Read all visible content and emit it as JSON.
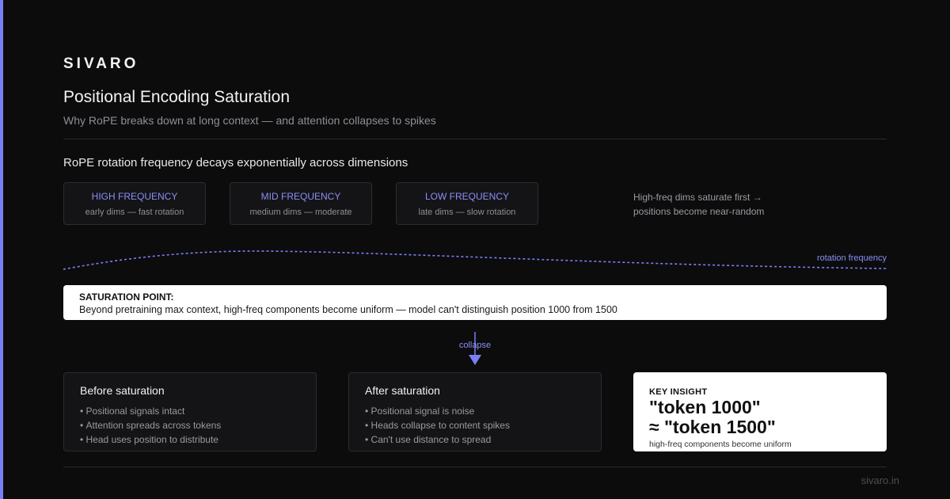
{
  "brand": "SIVARO",
  "title": "Positional Encoding Saturation",
  "subtitle": "Why RoPE breaks down at long context — and attention collapses to spikes",
  "section_heading": "RoPE rotation frequency decays exponentially across dimensions",
  "frequency_cards": [
    {
      "label": "HIGH FREQUENCY",
      "desc": "early dims — fast rotation"
    },
    {
      "label": "MID FREQUENCY",
      "desc": "medium dims — moderate"
    },
    {
      "label": "LOW FREQUENCY",
      "desc": "late dims — slow rotation"
    }
  ],
  "side_note": {
    "line1": "High-freq dims saturate first →",
    "line2": "positions become near-random"
  },
  "curve_label": "rotation frequency",
  "saturation": {
    "heading": "SATURATION POINT:",
    "body": "Beyond pretraining max context, high-freq components become uniform — model can't distinguish position 1000 from 1500"
  },
  "arrow_label": "collapse",
  "before": {
    "heading": "Before saturation",
    "items": [
      "Positional signals intact",
      "Attention spreads across tokens",
      "Head uses position to distribute"
    ]
  },
  "after": {
    "heading": "After saturation",
    "items": [
      "Positional signal is noise",
      "Heads collapse to content spikes",
      "Can't use distance to spread"
    ]
  },
  "insight": {
    "heading": "KEY INSIGHT",
    "line1": "\"token 1000\"",
    "line2": "≈ \"token 1500\"",
    "caption": "high-freq components become uniform"
  },
  "footer": "sivaro.in",
  "colors": {
    "background": "#0c0c0d",
    "accent": "#7b7ff5",
    "card": "#141416",
    "card_border": "#2c2c31"
  }
}
